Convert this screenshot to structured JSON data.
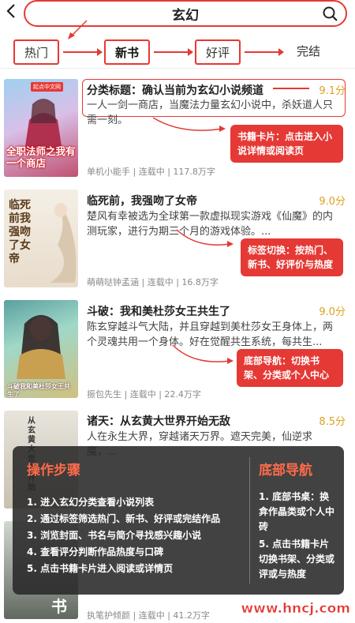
{
  "header": {
    "title": "玄幻"
  },
  "tabs": [
    "热门",
    "新书",
    "好评",
    "完结"
  ],
  "books": [
    {
      "title": "分类标题：确认当前为玄幻小说频道",
      "score": "9.1分",
      "desc": "一人一剑一商店，当魔法力量玄幻小说中，杀妖道人只需一刻。",
      "meta": "单机小能手 | 连载中 | 117.8万字",
      "cover_label": "全职法师之我有一个商店",
      "cover_publisher": "起点中文网"
    },
    {
      "title": "临死前，我强吻了女帝",
      "score": "9.0分",
      "desc": "楚风有幸被选为全球第一款虚拟现实游戏《仙魔》的内测玩家，进行为期三个月的游戏体验。...",
      "meta": "萌萌哒钟孟涵 | 连载中 | 16.8万字",
      "cover_label": "临死前我强吻了女帝"
    },
    {
      "title": "斗破：我和美杜莎女王共生了",
      "score": "9.0分",
      "desc": "陈玄穿越斗气大陆，并且穿越到美杜莎女王身体上，两个灵魂共用一个身体。好在觉醒共生系统，每共生...",
      "meta": "振包先生 | 连载中 | 22.4万字",
      "cover_label": "斗破我和美杜莎女王共生了",
      "cover_publisher": "起点中文网"
    },
    {
      "title": "诸天：从玄黄大世界开始无敌",
      "score": "8.5分",
      "desc": "人在永生大界，穿越诸天万界。遮天完美，仙逆求魔，...",
      "meta": "",
      "cover_label": "从玄黄大世界开始"
    },
    {
      "title": "",
      "score": "",
      "desc": "",
      "meta": "执笔护倾颜 | 连载中 | 41.2万字",
      "cover_label": "书"
    }
  ],
  "callouts": {
    "card": "书籍卡片：点击进入小说详情或阅读页",
    "tab": "标签切换：按热门、新书、好评价与热度",
    "nav": "底部导航：切换书架、分类或个人中心"
  },
  "overlay": {
    "steps_title": "操作步骤",
    "steps": [
      "1. 进入玄幻分类查看小说列表",
      "2. 通过标签筛选热门、新书、好评或完结作品",
      "3. 浏览封面、书名与简介寻找感兴趣小说",
      "4. 查看评分判断作品热度与口碑",
      "5. 点击书籍卡片进入阅读或详情页"
    ],
    "nav_title": "底部导航",
    "nav_items": [
      "1. 底部书桌：换弇作晶类或个人中砖",
      "5. 点击书籍卡片切换书架、分类或评或与热度"
    ]
  },
  "watermark": "www.hncj.com",
  "colors": {
    "accent": "#e53935",
    "score": "#e0a020",
    "overlay_title": "#ff6b4a"
  }
}
